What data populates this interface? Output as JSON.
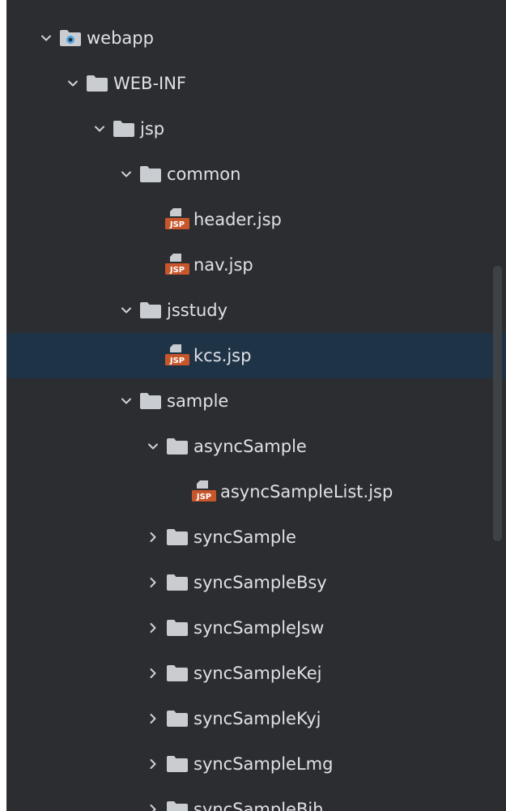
{
  "tree": {
    "items": [
      {
        "label": "webapp",
        "level": 0,
        "expanded": true,
        "icon": "web-folder"
      },
      {
        "label": "WEB-INF",
        "level": 1,
        "expanded": true,
        "icon": "folder"
      },
      {
        "label": "jsp",
        "level": 2,
        "expanded": true,
        "icon": "folder"
      },
      {
        "label": "common",
        "level": 3,
        "expanded": true,
        "icon": "folder"
      },
      {
        "label": "header.jsp",
        "level": 4,
        "icon": "jsp-file"
      },
      {
        "label": "nav.jsp",
        "level": 4,
        "icon": "jsp-file"
      },
      {
        "label": "jsstudy",
        "level": 3,
        "expanded": true,
        "icon": "folder"
      },
      {
        "label": "kcs.jsp",
        "level": 4,
        "icon": "jsp-file",
        "selected": true
      },
      {
        "label": "sample",
        "level": 3,
        "expanded": true,
        "icon": "folder"
      },
      {
        "label": "asyncSample",
        "level": 4,
        "expanded": true,
        "icon": "folder"
      },
      {
        "label": "asyncSampleList.jsp",
        "level": 5,
        "icon": "jsp-file"
      },
      {
        "label": "syncSample",
        "level": 4,
        "expanded": false,
        "icon": "folder"
      },
      {
        "label": "syncSampleBsy",
        "level": 4,
        "expanded": false,
        "icon": "folder"
      },
      {
        "label": "syncSampleJsw",
        "level": 4,
        "expanded": false,
        "icon": "folder"
      },
      {
        "label": "syncSampleKej",
        "level": 4,
        "expanded": false,
        "icon": "folder"
      },
      {
        "label": "syncSampleKyj",
        "level": 4,
        "expanded": false,
        "icon": "folder"
      },
      {
        "label": "syncSampleLmg",
        "level": 4,
        "expanded": false,
        "icon": "folder"
      },
      {
        "label": "syncSampleBjh",
        "level": 4,
        "expanded": false,
        "icon": "folder"
      }
    ]
  },
  "file_badge_text": "JSP",
  "colors": {
    "background": "#2b2d30",
    "selected_row": "#1f3347",
    "text": "#dfe1e5",
    "folder": "#c9ccd1",
    "chevron": "#cfd2d6",
    "jsp_badge": "#c7562b",
    "web_dot": "#4aa3e0"
  }
}
